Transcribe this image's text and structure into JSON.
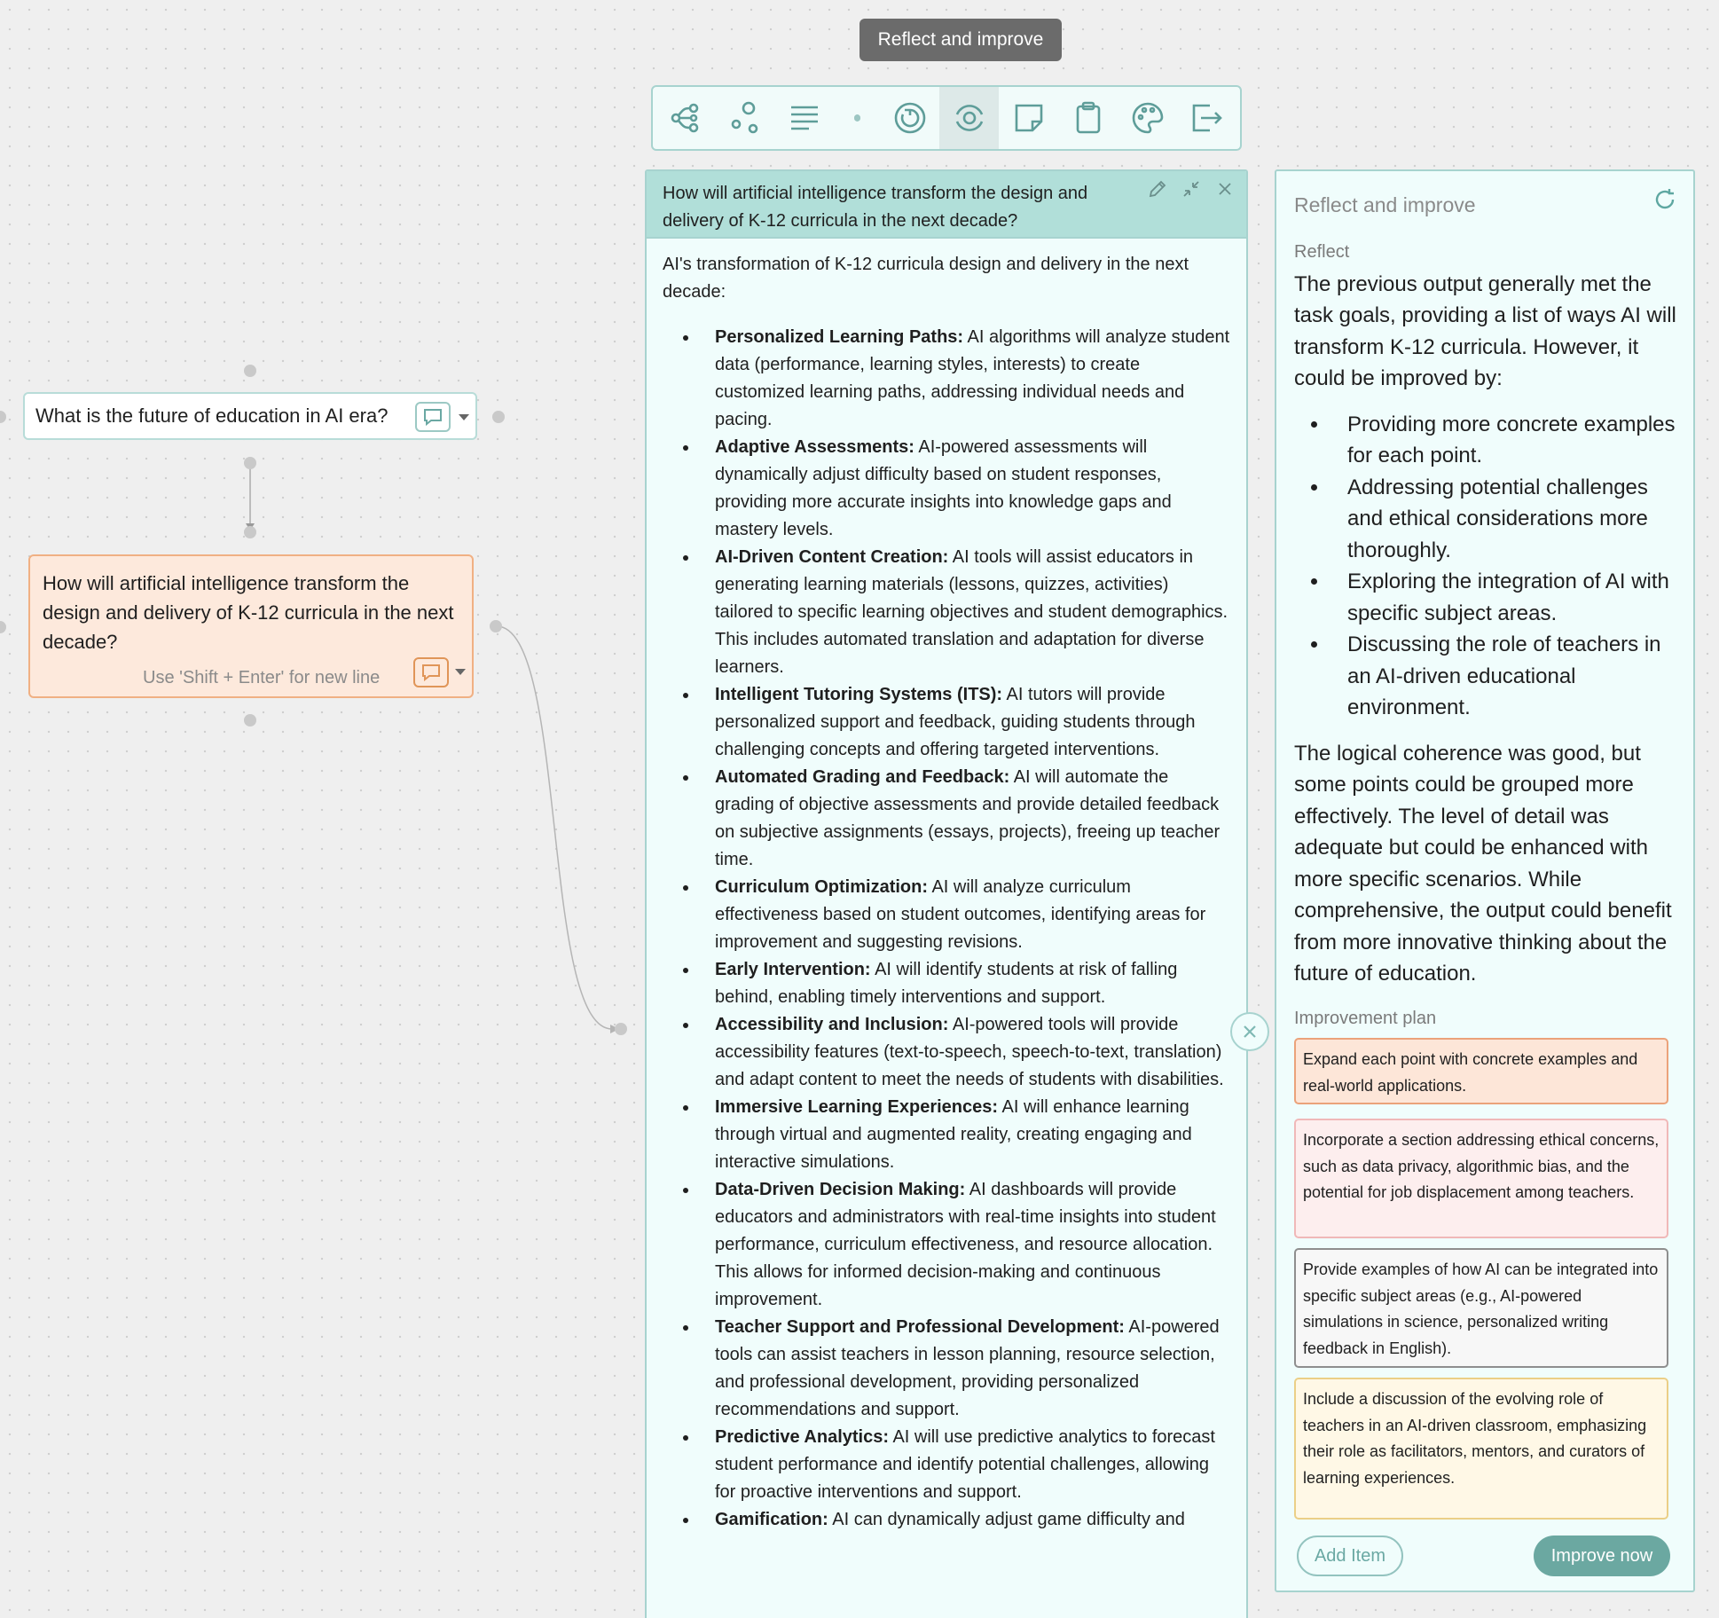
{
  "tooltip": "Reflect and improve",
  "toolbar": {
    "buttons": [
      "mindmap-icon",
      "nodes-icon",
      "text-lines-icon",
      "refresh-circle-icon",
      "reflect-icon",
      "sticky-note-icon",
      "clipboard-icon",
      "palette-icon",
      "exit-icon"
    ],
    "active": "reflect-icon"
  },
  "node1": {
    "text": "What is the future of education in AI era?"
  },
  "node2": {
    "text": "How will artificial intelligence transform the design and delivery of K-12 curricula in the next decade?",
    "hint": "Use 'Shift + Enter' for new line"
  },
  "main": {
    "title": "How will artificial intelligence transform the design and delivery of K-12 curricula in the next decade?",
    "intro": "AI's transformation of K-12 curricula design and delivery in the next decade:",
    "items": [
      {
        "title": "Personalized Learning Paths:",
        "text": " AI algorithms will analyze student data (performance, learning styles, interests) to create customized learning paths, addressing individual needs and pacing."
      },
      {
        "title": "Adaptive Assessments:",
        "text": " AI-powered assessments will dynamically adjust difficulty based on student responses, providing more accurate insights into knowledge gaps and mastery levels."
      },
      {
        "title": "AI-Driven Content Creation:",
        "text": " AI tools will assist educators in generating learning materials (lessons, quizzes, activities) tailored to specific learning objectives and student demographics. This includes automated translation and adaptation for diverse learners."
      },
      {
        "title": "Intelligent Tutoring Systems (ITS):",
        "text": " AI tutors will provide personalized support and feedback, guiding students through challenging concepts and offering targeted interventions."
      },
      {
        "title": "Automated Grading and Feedback:",
        "text": " AI will automate the grading of objective assessments and provide detailed feedback on subjective assignments (essays, projects), freeing up teacher time."
      },
      {
        "title": "Curriculum Optimization:",
        "text": " AI will analyze curriculum effectiveness based on student outcomes, identifying areas for improvement and suggesting revisions."
      },
      {
        "title": "Early Intervention:",
        "text": " AI will identify students at risk of falling behind, enabling timely interventions and support."
      },
      {
        "title": "Accessibility and Inclusion:",
        "text": " AI-powered tools will provide accessibility features (text-to-speech, speech-to-text, translation) and adapt content to meet the needs of students with disabilities."
      },
      {
        "title": "Immersive Learning Experiences:",
        "text": " AI will enhance learning through virtual and augmented reality, creating engaging and interactive simulations."
      },
      {
        "title": "Data-Driven Decision Making:",
        "text": " AI dashboards will provide educators and administrators with real-time insights into student performance, curriculum effectiveness, and resource allocation. This allows for informed decision-making and continuous improvement."
      },
      {
        "title": "Teacher Support and Professional Development:",
        "text": " AI-powered tools can assist teachers in lesson planning, resource selection, and professional development, providing personalized recommendations and support."
      },
      {
        "title": "Predictive Analytics:",
        "text": " AI will use predictive analytics to forecast student performance and identify potential challenges, allowing for proactive interventions and support."
      },
      {
        "title": "Gamification:",
        "text": " AI can dynamically adjust game difficulty and"
      }
    ]
  },
  "side": {
    "title": "Reflect and improve",
    "reflect_label": "Reflect",
    "reflect_intro": "The previous output generally met the task goals, providing a list of ways AI will transform K-12 curricula. However, it could be improved by:",
    "reflect_points": [
      "Providing more concrete examples for each point.",
      "Addressing potential challenges and ethical considerations more thoroughly.",
      "Exploring the integration of AI with specific subject areas.",
      "Discussing the role of teachers in an AI-driven educational environment."
    ],
    "reflect_outro": "The logical coherence was good, but some points could be grouped more effectively. The level of detail was adequate but could be enhanced with more specific scenarios. While comprehensive, the output could benefit from more innovative thinking about the future of education.",
    "plan_label": "Improvement plan",
    "plan": [
      "Expand each point with concrete examples and real-world applications.",
      "Incorporate a section addressing ethical concerns, such as data privacy, algorithmic bias, and the potential for job displacement among teachers.",
      "Provide examples of how AI can be integrated into specific subject areas (e.g., AI-powered simulations in science, personalized writing feedback in English).",
      "Include a discussion of the evolving role of teachers in an AI-driven classroom, emphasizing their role as facilitators, mentors, and curators of learning experiences."
    ],
    "add_item": "Add Item",
    "improve_now": "Improve now"
  }
}
